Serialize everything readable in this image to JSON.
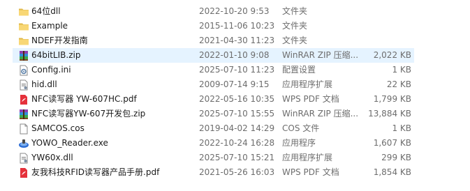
{
  "files": [
    {
      "name": "64位dll",
      "date": "2022-10-20 9:53",
      "type": "文件夹",
      "size": "",
      "icon": "folder-icon"
    },
    {
      "name": "Example",
      "date": "2015-11-06 10:23",
      "type": "文件夹",
      "size": "",
      "icon": "folder-icon"
    },
    {
      "name": "NDEF开发指南",
      "date": "2021-04-30 11:23",
      "type": "文件夹",
      "size": "",
      "icon": "folder-icon"
    },
    {
      "name": "64bitLIB.zip",
      "date": "2022-01-10 9:08",
      "type": "WinRAR ZIP 压缩...",
      "size": "2,022 KB",
      "icon": "winrar-archive-icon",
      "selected": true
    },
    {
      "name": "Config.ini",
      "date": "2025-07-10 11:23",
      "type": "配置设置",
      "size": "1 KB",
      "icon": "settings-file-icon"
    },
    {
      "name": "hid.dll",
      "date": "2009-07-14 9:15",
      "type": "应用程序扩展",
      "size": "22 KB",
      "icon": "dll-file-icon"
    },
    {
      "name": "NFC读写器 YW-607HC.pdf",
      "date": "2022-05-16 10:35",
      "type": "WPS PDF 文档",
      "size": "1,799 KB",
      "icon": "wps-pdf-icon"
    },
    {
      "name": "NFC读写器YW-607开发包.zip",
      "date": "2025-07-10 15:55",
      "type": "WinRAR ZIP 压缩...",
      "size": "13,884 KB",
      "icon": "winrar-archive-icon"
    },
    {
      "name": "SAMCOS.cos",
      "date": "2019-04-02 14:29",
      "type": "COS 文件",
      "size": "1 KB",
      "icon": "generic-file-icon"
    },
    {
      "name": "YOWO_Reader.exe",
      "date": "2022-10-24 16:28",
      "type": "应用程序",
      "size": "1,607 KB",
      "icon": "app-exe-icon"
    },
    {
      "name": "YW60x.dll",
      "date": "2025-07-10 15:21",
      "type": "应用程序扩展",
      "size": "299 KB",
      "icon": "dll-file-icon"
    },
    {
      "name": "友我科技RFID读写器产品手册.pdf",
      "date": "2021-05-26 16:03",
      "type": "WPS PDF 文档",
      "size": "1,854 KB",
      "icon": "wps-pdf-icon"
    }
  ],
  "colors": {
    "selected_row": "#e5f3ff",
    "folder": "#f8d775",
    "folder_dark": "#e0b84a",
    "pdf_red": "#e5313b",
    "exe_blue": "#2f6fd6",
    "secondary_text": "#6d6d6d"
  }
}
